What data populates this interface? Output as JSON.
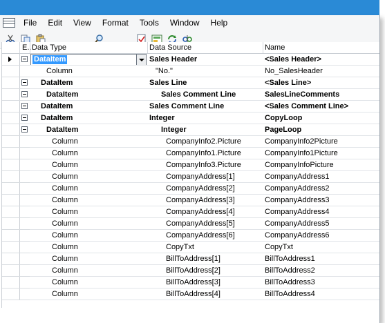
{
  "menu": {
    "items": [
      "File",
      "Edit",
      "View",
      "Format",
      "Tools",
      "Window",
      "Help"
    ]
  },
  "toolbar": {
    "buttons": [
      "cut-icon",
      "copy-icon",
      "paste-icon",
      "find-icon",
      "checklist-icon",
      "layout-icon",
      "sync-icon",
      "properties-icon"
    ]
  },
  "grid": {
    "headers": {
      "expand": "E..",
      "type": "Data Type",
      "source": "Data Source",
      "name": "Name"
    },
    "rows": [
      {
        "type": "DataItem",
        "source": "Sales Header",
        "name": "<Sales Header>",
        "bold": true,
        "expand": true,
        "indent": 0,
        "selected": true
      },
      {
        "type": "Column",
        "source": "\"No.\"",
        "name": "No_SalesHeader",
        "bold": false,
        "expand": false,
        "indent": 1
      },
      {
        "type": "DataItem",
        "source": "Sales Line",
        "name": "<Sales Line>",
        "bold": true,
        "expand": true,
        "indent": 0
      },
      {
        "type": "DataItem",
        "source": "Sales Comment Line",
        "name": "SalesLineComments",
        "bold": true,
        "expand": true,
        "indent": 1
      },
      {
        "type": "DataItem",
        "source": "Sales Comment Line",
        "name": "<Sales Comment Line>",
        "bold": true,
        "expand": true,
        "indent": 0
      },
      {
        "type": "DataItem",
        "source": "Integer",
        "name": "CopyLoop",
        "bold": true,
        "expand": true,
        "indent": 0
      },
      {
        "type": "DataItem",
        "source": "Integer",
        "name": "PageLoop",
        "bold": true,
        "expand": true,
        "indent": 1
      },
      {
        "type": "Column",
        "source": "CompanyInfo2.Picture",
        "name": "CompanyInfo2Picture",
        "bold": false,
        "expand": false,
        "indent": 2
      },
      {
        "type": "Column",
        "source": "CompanyInfo1.Picture",
        "name": "CompanyInfo1Picture",
        "bold": false,
        "expand": false,
        "indent": 2
      },
      {
        "type": "Column",
        "source": "CompanyInfo3.Picture",
        "name": "CompanyInfoPicture",
        "bold": false,
        "expand": false,
        "indent": 2
      },
      {
        "type": "Column",
        "source": "CompanyAddress[1]",
        "name": "CompanyAddress1",
        "bold": false,
        "expand": false,
        "indent": 2
      },
      {
        "type": "Column",
        "source": "CompanyAddress[2]",
        "name": "CompanyAddress2",
        "bold": false,
        "expand": false,
        "indent": 2
      },
      {
        "type": "Column",
        "source": "CompanyAddress[3]",
        "name": "CompanyAddress3",
        "bold": false,
        "expand": false,
        "indent": 2
      },
      {
        "type": "Column",
        "source": "CompanyAddress[4]",
        "name": "CompanyAddress4",
        "bold": false,
        "expand": false,
        "indent": 2
      },
      {
        "type": "Column",
        "source": "CompanyAddress[5]",
        "name": "CompanyAddress5",
        "bold": false,
        "expand": false,
        "indent": 2
      },
      {
        "type": "Column",
        "source": "CompanyAddress[6]",
        "name": "CompanyAddress6",
        "bold": false,
        "expand": false,
        "indent": 2
      },
      {
        "type": "Column",
        "source": "CopyTxt",
        "name": "CopyTxt",
        "bold": false,
        "expand": false,
        "indent": 2
      },
      {
        "type": "Column",
        "source": "BillToAddress[1]",
        "name": "BillToAddress1",
        "bold": false,
        "expand": false,
        "indent": 2
      },
      {
        "type": "Column",
        "source": "BillToAddress[2]",
        "name": "BillToAddress2",
        "bold": false,
        "expand": false,
        "indent": 2
      },
      {
        "type": "Column",
        "source": "BillToAddress[3]",
        "name": "BillToAddress3",
        "bold": false,
        "expand": false,
        "indent": 2
      },
      {
        "type": "Column",
        "source": "BillToAddress[4]",
        "name": "BillToAddress4",
        "bold": false,
        "expand": false,
        "indent": 2
      }
    ]
  }
}
